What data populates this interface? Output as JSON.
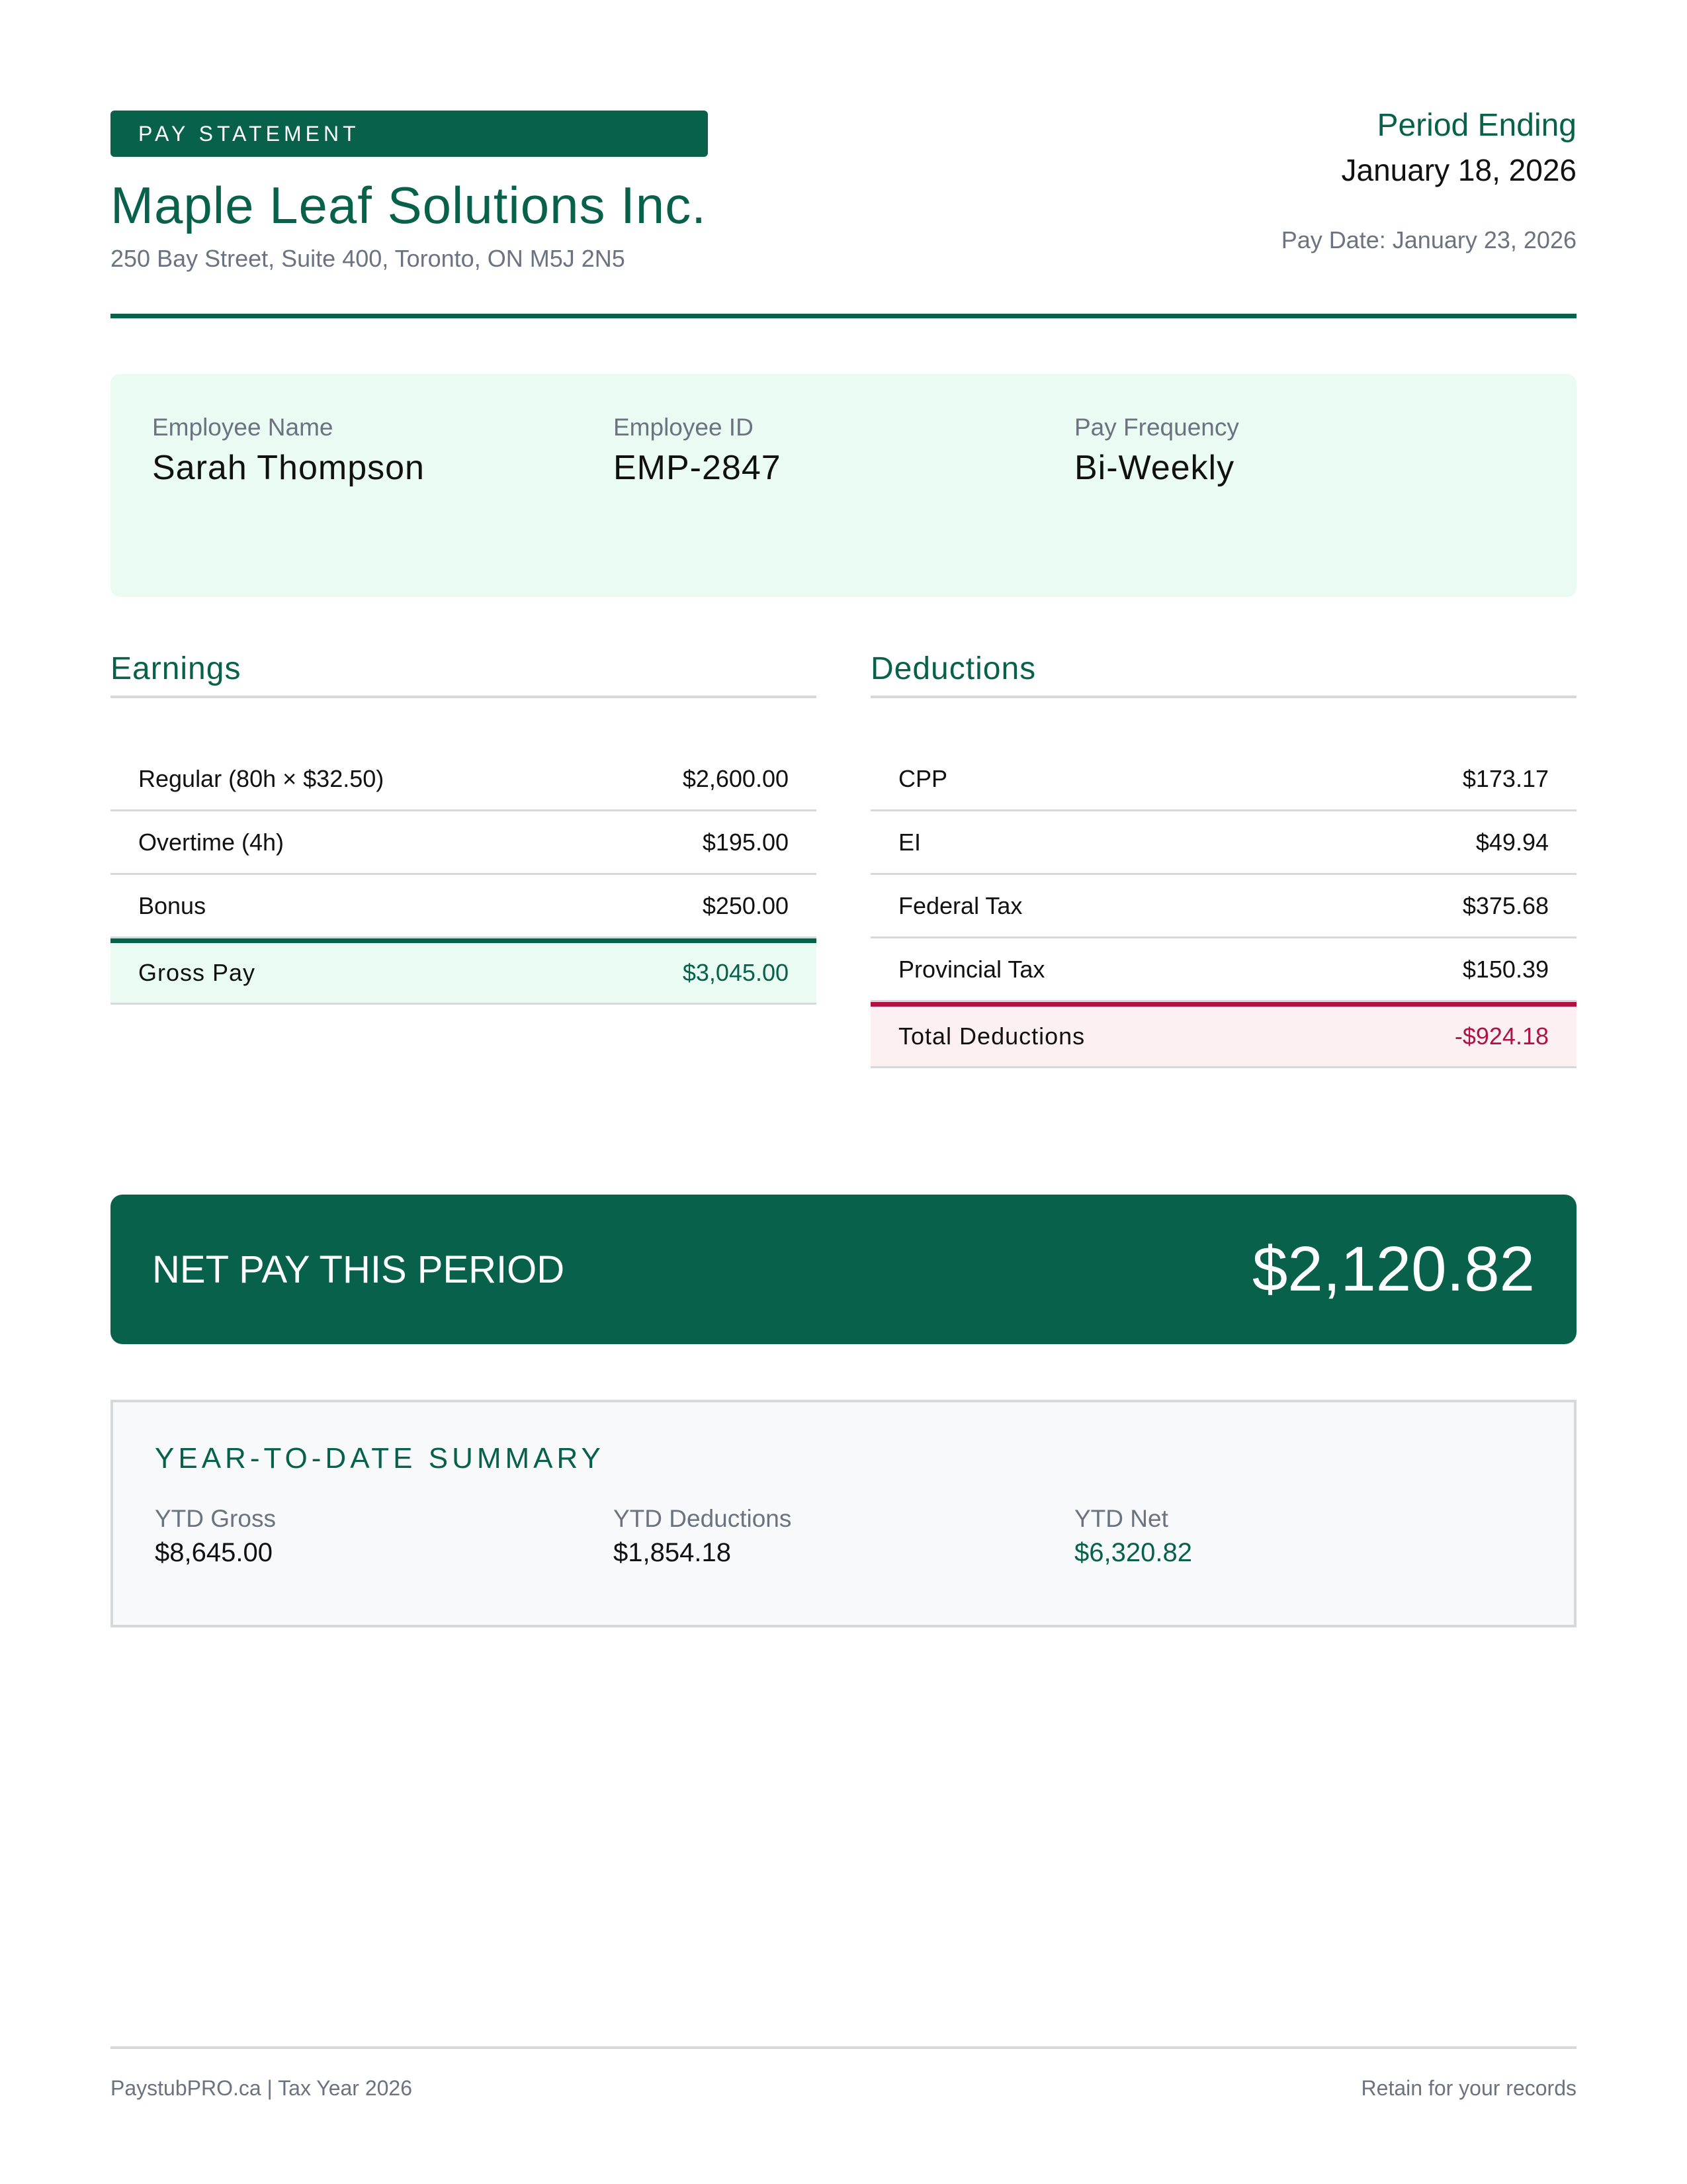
{
  "header": {
    "badge": "PAY STATEMENT",
    "company_name": "Maple Leaf Solutions Inc.",
    "company_address": "250 Bay Street, Suite 400, Toronto, ON M5J 2N5",
    "period_label": "Period Ending",
    "period_date": "January 18, 2026",
    "pay_date": "Pay Date: January 23, 2026"
  },
  "employee": {
    "name_label": "Employee Name",
    "name": "Sarah Thompson",
    "id_label": "Employee ID",
    "id": "EMP-2847",
    "frequency_label": "Pay Frequency",
    "frequency": "Bi-Weekly"
  },
  "earnings": {
    "title": "Earnings",
    "rows": [
      {
        "name": "Regular (80h × $32.50)",
        "amount": "$2,600.00"
      },
      {
        "name": "Overtime (4h)",
        "amount": "$195.00"
      },
      {
        "name": "Bonus",
        "amount": "$250.00"
      }
    ],
    "total_label": "Gross Pay",
    "total_amount": "$3,045.00"
  },
  "deductions": {
    "title": "Deductions",
    "rows": [
      {
        "name": "CPP",
        "amount": "$173.17"
      },
      {
        "name": "EI",
        "amount": "$49.94"
      },
      {
        "name": "Federal Tax",
        "amount": "$375.68"
      },
      {
        "name": "Provincial Tax",
        "amount": "$150.39"
      }
    ],
    "total_label": "Total Deductions",
    "total_amount": "-$924.18"
  },
  "net_pay": {
    "label": "NET PAY THIS PERIOD",
    "amount": "$2,120.82"
  },
  "ytd": {
    "title": "YEAR-TO-DATE SUMMARY",
    "gross_label": "YTD Gross",
    "gross": "$8,645.00",
    "deductions_label": "YTD Deductions",
    "deductions": "$1,854.18",
    "net_label": "YTD Net",
    "net": "$6,320.82"
  },
  "footer": {
    "left": "PaystubPRO.ca | Tax Year 2026",
    "right": "Retain for your records"
  },
  "colors": {
    "brand_green": "#08614a",
    "light_green": "#e9fbf2",
    "deduction_red": "#b01243",
    "light_red": "#fdf0f2",
    "muted_text": "#6b7280"
  }
}
